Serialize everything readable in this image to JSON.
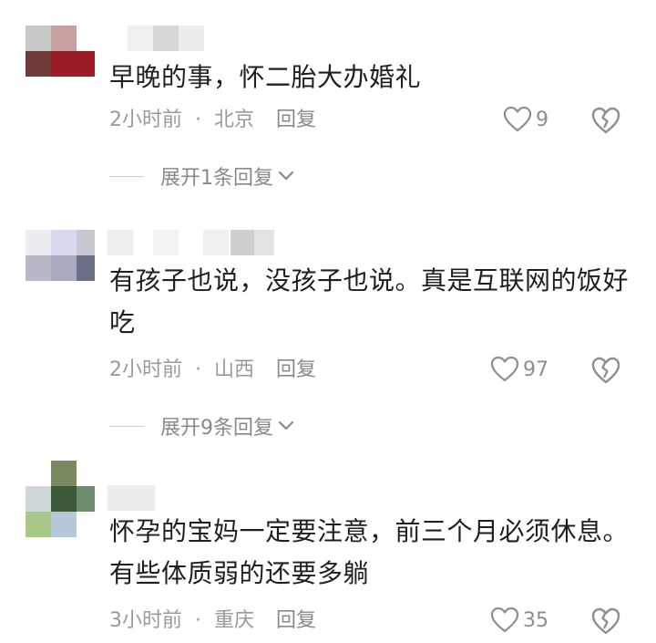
{
  "comments": [
    {
      "text": "早晚的事，怀二胎大办婚礼",
      "time": "2小时前",
      "location": "北京",
      "reply_label": "回复",
      "likes": "9",
      "expand_label": "展开1条回复"
    },
    {
      "text": "有孩子也说，没孩子也说。真是互联网的饭好吃",
      "time": "2小时前",
      "location": "山西",
      "reply_label": "回复",
      "likes": "97",
      "expand_label": "展开9条回复"
    },
    {
      "text": "怀孕的宝妈一定要注意，前三个月必须休息。有些体质弱的还要多躺",
      "time": "3小时前",
      "location": "重庆",
      "reply_label": "回复",
      "likes": "35"
    }
  ],
  "separator": "·",
  "icons": {
    "like": "heart-outline-icon",
    "dislike": "broken-heart-icon",
    "expand": "chevron-down-icon"
  },
  "colors": {
    "text": "#1f1f1f",
    "meta": "#9a9a9a",
    "icon": "#8e8e8e"
  }
}
